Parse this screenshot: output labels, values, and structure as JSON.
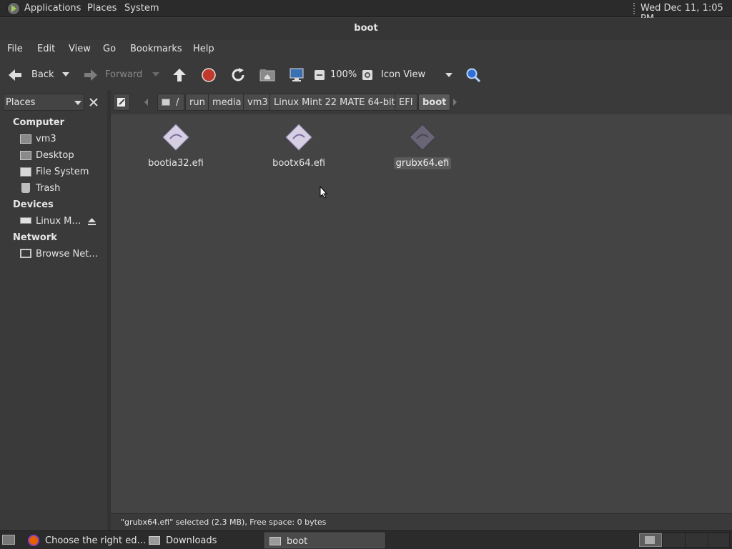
{
  "top_panel": {
    "menus": [
      "Applications",
      "Places",
      "System"
    ],
    "clock": "Wed Dec 11,  1:05 PM"
  },
  "window": {
    "title": "boot"
  },
  "menubar": [
    "File",
    "Edit",
    "View",
    "Go",
    "Bookmarks",
    "Help"
  ],
  "toolbar": {
    "back": "Back",
    "forward": "Forward",
    "zoom": "100%",
    "view_mode": "Icon View"
  },
  "sidebar": {
    "selector": "Places",
    "sections": [
      {
        "title": "Computer",
        "items": [
          "vm3",
          "Desktop",
          "File System",
          "Trash"
        ]
      },
      {
        "title": "Devices",
        "items": [
          "Linux M…"
        ]
      },
      {
        "title": "Network",
        "items": [
          "Browse Net…"
        ]
      }
    ]
  },
  "breadcrumb": [
    "/",
    "run",
    "media",
    "vm3",
    "Linux Mint 22 MATE 64-bit",
    "EFI",
    "boot"
  ],
  "files": [
    {
      "name": "bootia32.efi",
      "selected": false
    },
    {
      "name": "bootx64.efi",
      "selected": false
    },
    {
      "name": "grubx64.efi",
      "selected": true
    }
  ],
  "status": "\"grubx64.efi\" selected (2.3 MB), Free space: 0 bytes",
  "taskbar": {
    "items": [
      "Choose the right ed…",
      "Downloads",
      "boot"
    ]
  },
  "colors": {
    "selected_label_bg": "#5a5a5a",
    "window_bg": "#3a3a3a",
    "stop": "#c0392b",
    "search": "#2f6fd6"
  }
}
